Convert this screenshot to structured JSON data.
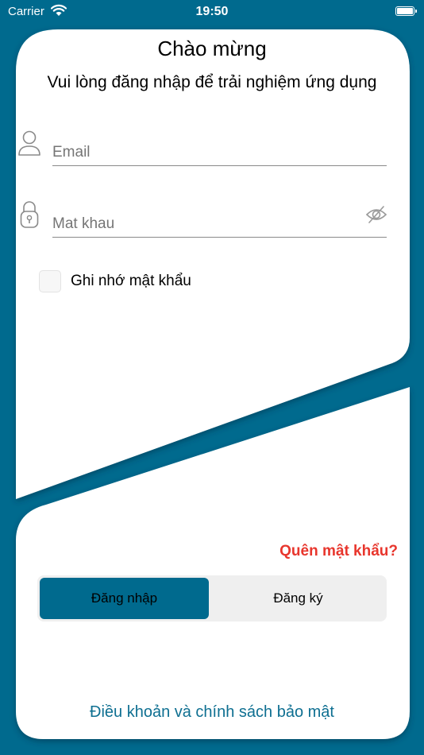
{
  "status_bar": {
    "carrier": "Carrier",
    "time": "19:50"
  },
  "header": {
    "title": "Chào mừng",
    "subtitle": "Vui lòng đăng nhập để trải nghiệm ứng dụng"
  },
  "form": {
    "email_placeholder": "Email",
    "password_placeholder": "Mat khau",
    "remember_label": "Ghi nhớ mật khẩu",
    "forgot_label": "Quên mật khẩu?"
  },
  "tabs": {
    "login_label": "Đăng nhập",
    "register_label": "Đăng ký",
    "selected": "login"
  },
  "footer": {
    "terms_label": "Điều khoản và chính sách bảo mật"
  },
  "colors": {
    "brand": "#006a8e",
    "forgot": "#e8362d",
    "link": "#0e6f91"
  },
  "icons": [
    "user-icon",
    "lock-icon",
    "eye-slash-icon",
    "wifi-icon",
    "battery-icon"
  ]
}
